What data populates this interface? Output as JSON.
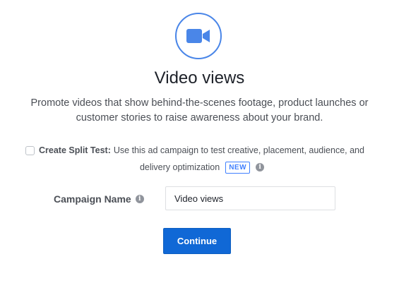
{
  "objective": {
    "icon": "video-camera-icon",
    "title": "Video views",
    "description": "Promote videos that show behind-the-scenes footage, product launches or customer stories to raise awareness about your brand."
  },
  "split_test": {
    "checked": false,
    "label": "Create Split Test:",
    "text_line1": "Use this ad campaign to test creative, placement, audience, and",
    "text_line2": "delivery optimization",
    "badge": "NEW",
    "info_icon": "info-icon"
  },
  "campaign_name": {
    "label": "Campaign Name",
    "value": "Video views",
    "info_icon": "info-icon"
  },
  "actions": {
    "continue_label": "Continue"
  },
  "colors": {
    "accent": "#4a86e8",
    "primary_button": "#1068d6",
    "badge": "#4080ff"
  }
}
